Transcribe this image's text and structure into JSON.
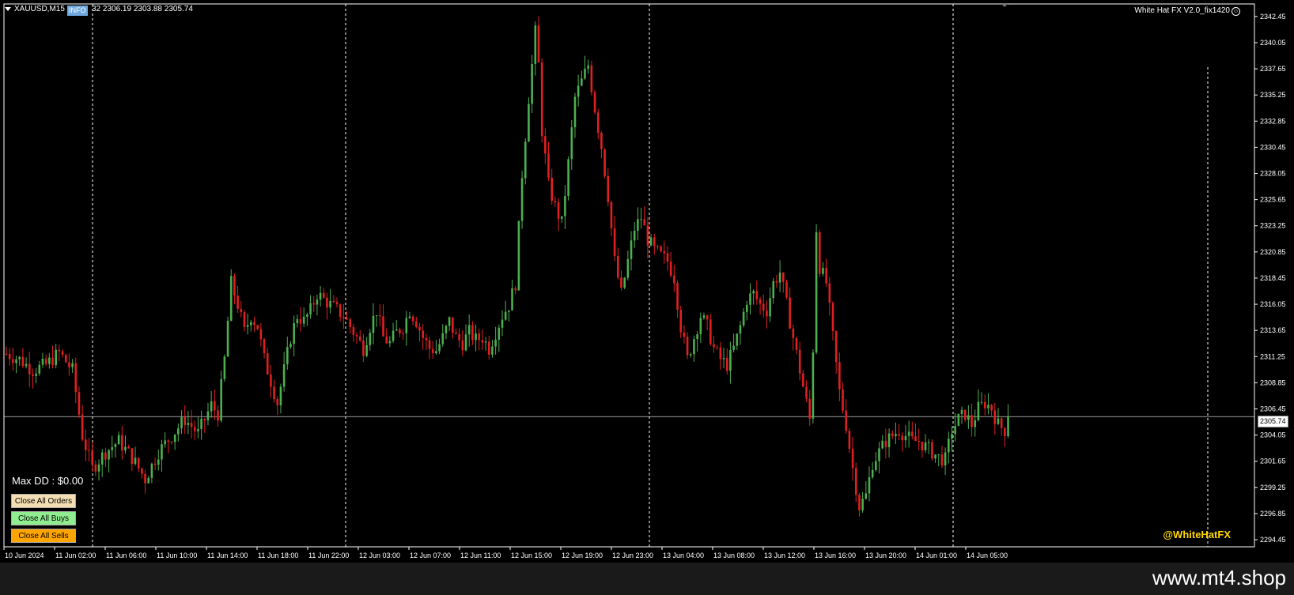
{
  "header": {
    "symbol": "XAUUSD,M15",
    "info_label": "INFO",
    "ohlc_text": "32 2306.19 2303.88 2305.74"
  },
  "indicator_name": "White Hat FX V2.0_fix1420",
  "max_dd": "Max DD : $0.00",
  "buttons": {
    "close_all_orders": "Close All Orders",
    "close_all_buys": "Close All Buys",
    "close_all_sells": "Close All Sells"
  },
  "watermark": "@WhiteHatFX",
  "site": "www.mt4.shop",
  "colors": {
    "background": "#000000",
    "bull": "#4caf50",
    "bear": "#e02020",
    "text": "#ffffff",
    "grid": "#ffffff"
  },
  "chart_data": {
    "type": "candlestick",
    "symbol": "XAUUSD",
    "timeframe": "M15",
    "current_price": "2305.74",
    "y_ticks": [
      "2342.45",
      "2340.05",
      "2337.65",
      "2335.25",
      "2332.85",
      "2330.45",
      "2328.05",
      "2325.65",
      "2323.25",
      "2320.85",
      "2318.45",
      "2316.05",
      "2313.65",
      "2311.25",
      "2308.85",
      "2306.45",
      "2304.05",
      "2301.65",
      "2299.25",
      "2296.85",
      "2294.45"
    ],
    "ylim": [
      2293.8,
      2343.6
    ],
    "x_ticks": [
      "10 Jun 2024",
      "11 Jun 02:00",
      "11 Jun 06:00",
      "11 Jun 10:00",
      "11 Jun 14:00",
      "11 Jun 18:00",
      "11 Jun 22:00",
      "12 Jun 03:00",
      "12 Jun 07:00",
      "12 Jun 11:00",
      "12 Jun 15:00",
      "12 Jun 19:00",
      "12 Jun 23:00",
      "13 Jun 04:00",
      "13 Jun 08:00",
      "13 Jun 12:00",
      "13 Jun 16:00",
      "13 Jun 20:00",
      "14 Jun 01:00",
      "14 Jun 05:00"
    ],
    "dashed_separators_after_tick": [
      "11 Jun 02:00",
      "11 Jun 22:00",
      "12 Jun 23:00",
      "14 Jun 01:00"
    ],
    "close_path": [
      [
        0,
        2311.5
      ],
      [
        4,
        2311.0
      ],
      [
        8,
        2310.0
      ],
      [
        12,
        2310.5
      ],
      [
        16,
        2311.6
      ],
      [
        20,
        2310.0
      ],
      [
        23,
        2304.0
      ],
      [
        26,
        2301.0
      ],
      [
        30,
        2302.5
      ],
      [
        34,
        2303.5
      ],
      [
        38,
        2302.0
      ],
      [
        42,
        2300.0
      ],
      [
        46,
        2302.5
      ],
      [
        50,
        2304.0
      ],
      [
        54,
        2305.5
      ],
      [
        58,
        2304.2
      ],
      [
        62,
        2306.8
      ],
      [
        64,
        2306.0
      ],
      [
        66,
        2311.0
      ],
      [
        68,
        2318.0
      ],
      [
        70,
        2316.0
      ],
      [
        72,
        2313.5
      ],
      [
        74,
        2315.0
      ],
      [
        76,
        2314.0
      ],
      [
        78,
        2311.0
      ],
      [
        80,
        2309.0
      ],
      [
        82,
        2307.0
      ],
      [
        84,
        2310.0
      ],
      [
        86,
        2313.0
      ],
      [
        88,
        2315.0
      ],
      [
        90,
        2314.5
      ],
      [
        92,
        2315.5
      ],
      [
        94,
        2317.0
      ],
      [
        96,
        2316.5
      ],
      [
        98,
        2316.0
      ],
      [
        100,
        2315.5
      ],
      [
        102,
        2315.0
      ],
      [
        104,
        2314.0
      ],
      [
        106,
        2313.0
      ],
      [
        108,
        2312.0
      ],
      [
        110,
        2314.0
      ],
      [
        112,
        2315.5
      ],
      [
        114,
        2313.0
      ],
      [
        116,
        2312.5
      ],
      [
        118,
        2313.5
      ],
      [
        120,
        2314.0
      ],
      [
        122,
        2315.5
      ],
      [
        124,
        2314.5
      ],
      [
        126,
        2313.0
      ],
      [
        128,
        2312.0
      ],
      [
        130,
        2311.8
      ],
      [
        132,
        2313.0
      ],
      [
        134,
        2314.5
      ],
      [
        136,
        2313.0
      ],
      [
        138,
        2312.5
      ],
      [
        140,
        2313.5
      ],
      [
        142,
        2312.8
      ],
      [
        144,
        2313.0
      ],
      [
        146,
        2312.0
      ],
      [
        148,
        2313.5
      ],
      [
        150,
        2315.0
      ],
      [
        152,
        2316.0
      ],
      [
        154,
        2318.0
      ],
      [
        156,
        2328.0
      ],
      [
        158,
        2335.0
      ],
      [
        160,
        2341.0
      ],
      [
        161,
        2338.0
      ],
      [
        162,
        2332.0
      ],
      [
        164,
        2327.0
      ],
      [
        166,
        2325.0
      ],
      [
        168,
        2323.5
      ],
      [
        170,
        2329.0
      ],
      [
        172,
        2335.0
      ],
      [
        174,
        2336.5
      ],
      [
        176,
        2338.0
      ],
      [
        178,
        2334.0
      ],
      [
        180,
        2330.5
      ],
      [
        182,
        2326.0
      ],
      [
        184,
        2320.0
      ],
      [
        186,
        2317.0
      ],
      [
        188,
        2320.0
      ],
      [
        190,
        2323.0
      ],
      [
        192,
        2324.0
      ],
      [
        194,
        2322.0
      ],
      [
        196,
        2321.0
      ],
      [
        198,
        2320.5
      ],
      [
        200,
        2320.0
      ],
      [
        202,
        2318.5
      ],
      [
        204,
        2314.0
      ],
      [
        206,
        2311.0
      ],
      [
        208,
        2313.0
      ],
      [
        210,
        2315.0
      ],
      [
        212,
        2314.0
      ],
      [
        214,
        2312.0
      ],
      [
        216,
        2311.0
      ],
      [
        218,
        2310.5
      ],
      [
        220,
        2312.0
      ],
      [
        222,
        2314.0
      ],
      [
        224,
        2316.5
      ],
      [
        226,
        2317.0
      ],
      [
        228,
        2316.0
      ],
      [
        230,
        2315.5
      ],
      [
        232,
        2318.0
      ],
      [
        234,
        2319.0
      ],
      [
        236,
        2316.0
      ],
      [
        238,
        2313.0
      ],
      [
        240,
        2310.0
      ],
      [
        242,
        2307.0
      ],
      [
        243,
        2305.5
      ],
      [
        244,
        2312.0
      ],
      [
        245,
        2323.0
      ],
      [
        246,
        2319.5
      ],
      [
        248,
        2318.0
      ],
      [
        250,
        2313.0
      ],
      [
        252,
        2308.0
      ],
      [
        254,
        2305.0
      ],
      [
        256,
        2301.0
      ],
      [
        258,
        2297.5
      ],
      [
        260,
        2298.5
      ],
      [
        262,
        2301.5
      ],
      [
        264,
        2302.5
      ],
      [
        266,
        2303.5
      ],
      [
        268,
        2304.0
      ],
      [
        270,
        2304.5
      ],
      [
        272,
        2304.0
      ],
      [
        274,
        2303.5
      ],
      [
        276,
        2303.5
      ],
      [
        278,
        2303.0
      ],
      [
        280,
        2302.5
      ],
      [
        282,
        2302.0
      ],
      [
        284,
        2301.8
      ],
      [
        286,
        2304.5
      ],
      [
        288,
        2305.5
      ],
      [
        290,
        2306.0
      ],
      [
        292,
        2305.0
      ],
      [
        294,
        2306.5
      ],
      [
        296,
        2307.0
      ],
      [
        298,
        2306.5
      ],
      [
        300,
        2305.0
      ],
      [
        302,
        2304.5
      ],
      [
        303,
        2305.74
      ]
    ],
    "total_bars": 304
  }
}
